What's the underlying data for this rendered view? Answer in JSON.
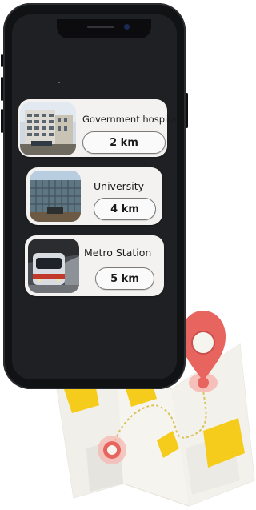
{
  "places": [
    {
      "name": "Government hospital",
      "distance": "2 km",
      "image": "hospital-building"
    },
    {
      "name": "University",
      "distance": "4 km",
      "image": "university-building"
    },
    {
      "name": "Metro Station",
      "distance": "5 km",
      "image": "metro-train"
    }
  ],
  "colors": {
    "phone_body": "#111214",
    "screen_bg": "#1f2023",
    "card_bg": "#f4f2f1",
    "map_pin": "#e8645f",
    "map_yellow": "#f5cb1c",
    "map_paper": "#f6f4ef"
  },
  "icons": [
    "map-pin-icon",
    "map-start-marker-icon",
    "folded-map-icon"
  ]
}
